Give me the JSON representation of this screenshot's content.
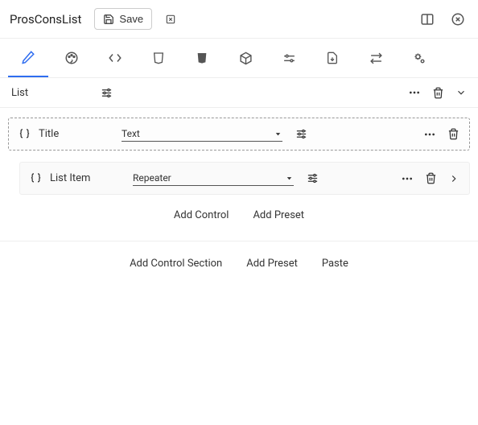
{
  "header": {
    "title": "ProsConsList",
    "save_label": "Save"
  },
  "section": {
    "label": "List"
  },
  "controls": [
    {
      "label": "Title",
      "type": "Text"
    },
    {
      "label": "List Item",
      "type": "Repeater"
    }
  ],
  "row_actions": {
    "add_control": "Add Control",
    "add_preset": "Add Preset"
  },
  "footer_actions": {
    "add_control_section": "Add Control Section",
    "add_preset": "Add Preset",
    "paste": "Paste"
  }
}
